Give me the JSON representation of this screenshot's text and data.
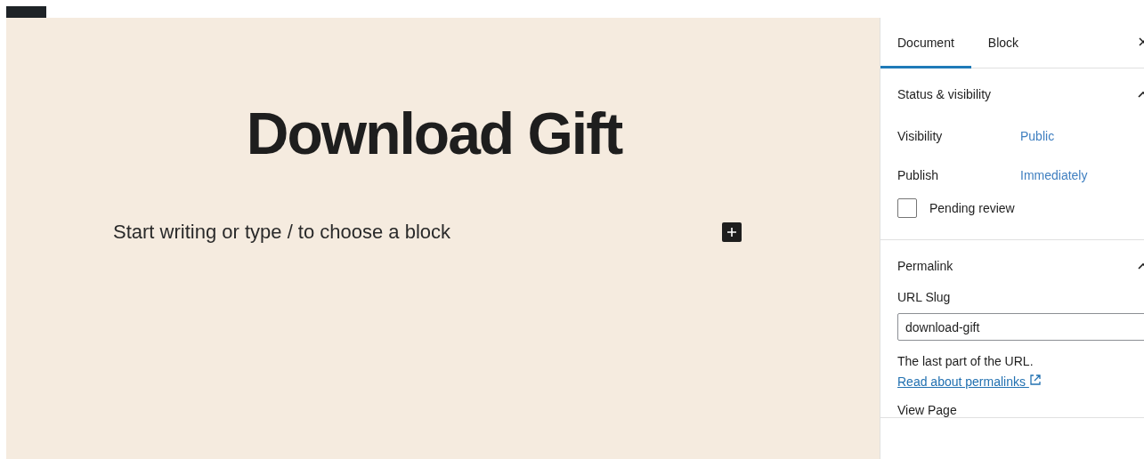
{
  "editor": {
    "title": "Download Gift",
    "block": {
      "placeholder": "Start writing or type / to choose a block"
    }
  },
  "sidebar": {
    "tabs": [
      {
        "label": "Document",
        "selected": true
      },
      {
        "label": "Block",
        "selected": false
      }
    ],
    "panels": [
      {
        "title": "Status & visibility",
        "expanded": true,
        "kind": "status",
        "rows": [
          {
            "label": "Visibility",
            "value": "Public"
          },
          {
            "label": "Publish",
            "value": "Immediately"
          }
        ],
        "checkbox": {
          "label": "Pending review",
          "checked": false
        }
      },
      {
        "title": "Permalink",
        "expanded": true,
        "kind": "permalink",
        "field_label": "URL Slug",
        "value": "download-gift",
        "help": "The last part of the URL.",
        "link": "Read about permalinks",
        "next_label": "View Page"
      }
    ]
  }
}
